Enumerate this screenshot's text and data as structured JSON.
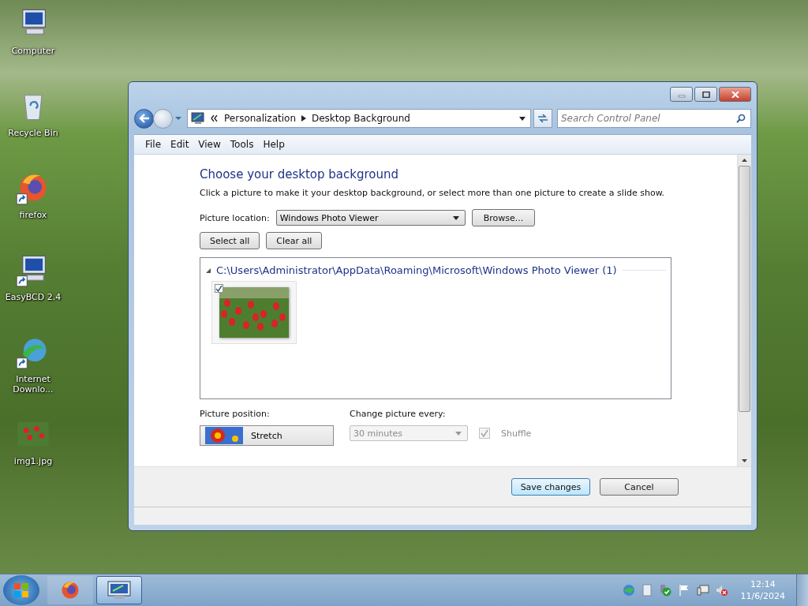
{
  "desktop_icons": [
    {
      "label": "Computer",
      "kind": "computer",
      "shortcut": false
    },
    {
      "label": "Recycle Bin",
      "kind": "bin",
      "shortcut": false
    },
    {
      "label": "firefox",
      "kind": "firefox",
      "shortcut": true
    },
    {
      "label": "EasyBCD 2.4",
      "kind": "computer",
      "shortcut": true
    },
    {
      "label": "Internet Downlo...",
      "kind": "globe",
      "shortcut": true
    },
    {
      "label": "img1.jpg",
      "kind": "image",
      "shortcut": false
    }
  ],
  "window": {
    "address": {
      "crumbs": [
        "Personalization",
        "Desktop Background"
      ]
    },
    "search": {
      "placeholder": "Search Control Panel"
    },
    "menu": [
      "File",
      "Edit",
      "View",
      "Tools",
      "Help"
    ],
    "heading": "Choose your desktop background",
    "description": "Click a picture to make it your desktop background, or select more than one picture to create a slide show.",
    "picture_location": {
      "label": "Picture location:",
      "value": "Windows Photo Viewer"
    },
    "browse_button": "Browse...",
    "select_all_button": "Select all",
    "clear_all_button": "Clear all",
    "group": {
      "title": "C:\\Users\\Administrator\\AppData\\Roaming\\Microsoft\\Windows Photo Viewer (1)",
      "expanded": true,
      "pictures": [
        {
          "checked": true
        }
      ]
    },
    "position": {
      "label": "Picture position:",
      "value": "Stretch"
    },
    "interval": {
      "label": "Change picture every:",
      "value": "30 minutes",
      "disabled": true
    },
    "shuffle": {
      "label": "Shuffle",
      "checked": true,
      "disabled": true
    },
    "buttons": [
      {
        "label": "Save changes",
        "default": true
      },
      {
        "label": "Cancel",
        "default": false
      }
    ]
  },
  "taskbar": {
    "pinned": [
      {
        "kind": "firefox",
        "selected": false
      },
      {
        "kind": "control-panel",
        "selected": true
      }
    ],
    "clock": {
      "time": "12:14",
      "date": "11/6/2024"
    }
  }
}
